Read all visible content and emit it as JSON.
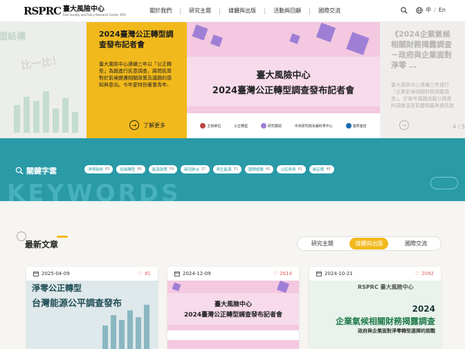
{
  "header": {
    "logo_mark": "RSPRC",
    "logo_zh": "臺大風險中心",
    "logo_en": "Risk Society and Policy Research Center, NTU",
    "nav": [
      "關於我們",
      "研究主題",
      "媒體與出版",
      "活動與回顧",
      "國際交流"
    ],
    "lang_zh": "中",
    "lang_sep": "/",
    "lang_en": "En"
  },
  "carousel": {
    "left_title": "盟結構",
    "left_mid": "比一比！",
    "current": {
      "title": "2024臺灣公正轉型調查發布記者會",
      "desc": "臺大風險中心連續三年以「公正轉型」為題進行民意調查，將問民眾對於氣候變遷相關政策及議題的感知與意向。今年更特別著重青年、勞工與 …",
      "more": "了解更多"
    },
    "banner": {
      "line1": "臺大風險中心",
      "line2": "2024臺灣公正轉型調查發布記者會",
      "sponsors": [
        "主辦單位",
        "公正轉型",
        "研究贊助",
        "中央研究院永續科學中心",
        "富邦金控"
      ]
    },
    "next": {
      "title": "《2024企業氣候相關財務揭露調查－政府與企業面對淨零 …",
      "desc": "臺大風險中心連續三年進行「企業氣候相關財務揭露調查」，於每年議題追蹤公開資料調查溫室氣體揭露與資訊披露專文公開，今年2024第三期 …"
    },
    "counter": "4 / 5"
  },
  "keywords": {
    "title": "關鍵字雲",
    "bg_word": "KEYWORDS",
    "tags": [
      {
        "label": "淨零碳排",
        "count": "83"
      },
      {
        "label": "低碳轉型",
        "count": "66"
      },
      {
        "label": "能源政策",
        "count": "59"
      },
      {
        "label": "新冠肺炎",
        "count": "57"
      },
      {
        "label": "再生能源",
        "count": "51"
      },
      {
        "label": "國際經驗",
        "count": "42"
      },
      {
        "label": "公民參與",
        "count": "41"
      },
      {
        "label": "碳定價",
        "count": "40"
      }
    ]
  },
  "latest": {
    "title": "最新文章",
    "tabs": [
      "研究主題",
      "媒體與出版",
      "國際交流"
    ],
    "active_tab": 1,
    "cards": [
      {
        "date": "2025-04-09",
        "likes": "81",
        "t1": "淨零公正轉型",
        "t2": "台灣能源公平調查發布"
      },
      {
        "date": "2024-12-09",
        "likes": "2614",
        "t1": "臺大風險中心",
        "t2": "2024臺灣公正轉型調查發布記者會"
      },
      {
        "date": "2024-10-21",
        "likes": "2092",
        "logo": "RSPRC 臺大風險中心",
        "t1": "2024",
        "t2": "企業氣候相關財務揭露調查",
        "t3": "政府與企業面對淨零轉型選擇的挑戰"
      }
    ]
  },
  "colors": {
    "accent": "#f2b91c",
    "teal": "#2a9aa7",
    "pink": "#f3c8e0",
    "purple": "#9f7fd6"
  }
}
